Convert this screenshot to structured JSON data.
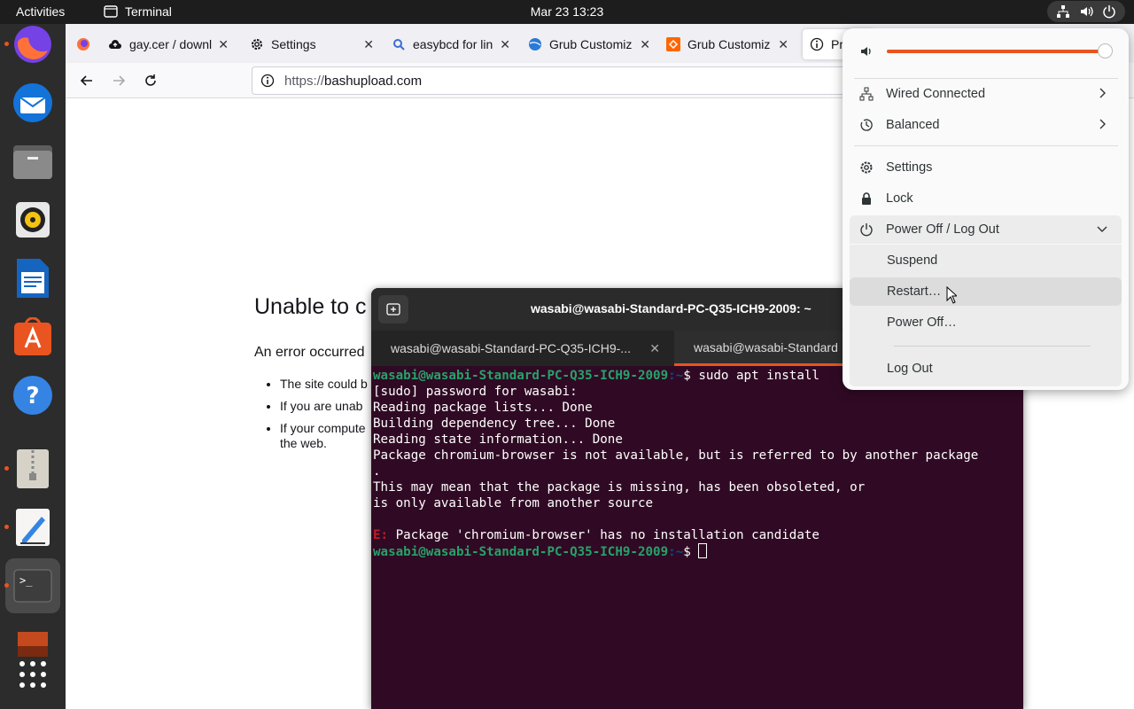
{
  "topbar": {
    "activities": "Activities",
    "app_name": "Terminal",
    "clock": "Mar 23  13:23"
  },
  "dock": {
    "items": [
      {
        "name": "firefox-icon",
        "running": true
      },
      {
        "name": "thunderbird-icon",
        "running": false
      },
      {
        "name": "files-icon",
        "running": false
      },
      {
        "name": "rhythmbox-icon",
        "running": false
      },
      {
        "name": "writer-icon",
        "running": false
      },
      {
        "name": "app-center-icon",
        "running": false
      },
      {
        "name": "help-icon",
        "running": false
      },
      {
        "name": "archive-manager-icon",
        "running": true
      },
      {
        "name": "text-editor-icon",
        "running": true
      },
      {
        "name": "terminal-icon",
        "running": true
      },
      {
        "name": "image-icon",
        "running": false
      },
      {
        "name": "show-apps-icon",
        "running": false
      }
    ]
  },
  "browser": {
    "tabs": [
      {
        "label": "gay.cer / downl",
        "icon": "cloud-upload-icon"
      },
      {
        "label": "Settings",
        "icon": "gear-icon"
      },
      {
        "label": "easybcd for lin",
        "icon": "search-icon"
      },
      {
        "label": "Grub Customiz",
        "icon": "globe-icon"
      },
      {
        "label": "Grub Customiz",
        "icon": "sourceforge-icon"
      },
      {
        "label": "Pr",
        "icon": "info-icon"
      }
    ],
    "url_scheme": "https://",
    "url_host": "bashupload.com",
    "error_title": "Unable to c",
    "error_desc": "An error occurred",
    "error_items": [
      "The site could b",
      "If you are unab",
      "If your compute",
      "the web."
    ]
  },
  "terminal": {
    "title": "wasabi@wasabi-Standard-PC-Q35-ICH9-2009: ~",
    "tabs": [
      {
        "label": "wasabi@wasabi-Standard-PC-Q35-ICH9-..."
      },
      {
        "label": "wasabi@wasabi-Standard"
      }
    ],
    "prompt_user": "wasabi@wasabi-Standard-PC-Q35-ICH9-2009",
    "prompt_path": ":~",
    "prompt_sign": "$ ",
    "command": "sudo apt install",
    "lines": [
      "[sudo] password for wasabi:",
      "Reading package lists... Done",
      "Building dependency tree... Done",
      "Reading state information... Done",
      "Package chromium-browser is not available, but is referred to by another package",
      ".",
      "This may mean that the package is missing, has been obsoleted, or",
      "is only available from another source",
      ""
    ],
    "error_prefix": "E:",
    "error_msg": " Package 'chromium-browser' has no installation candidate"
  },
  "system_menu": {
    "volume_level": 1.0,
    "items": {
      "wired": "Wired Connected",
      "power_mode": "Balanced",
      "settings": "Settings",
      "lock": "Lock",
      "power_off_logout": "Power Off / Log Out",
      "suspend": "Suspend",
      "restart": "Restart…",
      "power_off": "Power Off…",
      "log_out": "Log Out"
    }
  },
  "colors": {
    "accent": "#e95420",
    "terminal_bg": "#300a24",
    "prompt_green": "#26a269"
  }
}
